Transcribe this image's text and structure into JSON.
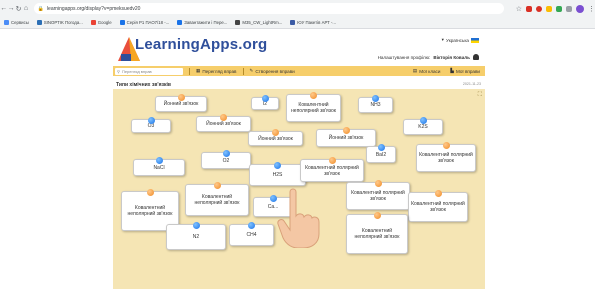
{
  "browser": {
    "url": "learningapps.org/display?v=pmeksuedv20",
    "bookmarks": [
      {
        "label": "Сервисы",
        "color": "#4a8cf6"
      },
      {
        "label": "SINOPTIK Погода...",
        "color": "#2c6fb5"
      },
      {
        "label": "Google",
        "color": "#ea4335"
      },
      {
        "label": "Серія Р1 ПАО7/18 -...",
        "color": "#1a73e8"
      },
      {
        "label": "Завантажити і Пере...",
        "color": "#1a73e8"
      },
      {
        "label": "M35_CW_LightRm...",
        "color": "#444444"
      },
      {
        "label": "ЮУ Пакетів АРТ -...",
        "color": "#3b5ba5"
      }
    ]
  },
  "header": {
    "logo": "LearningApps.org",
    "language": "Українська",
    "profile_label": "Налаштування профілю:",
    "profile_name": "Вікторія Коваль"
  },
  "toolbar": {
    "search_placeholder": "Перегляд вправ",
    "browse": "Перегляд вправ",
    "create": "Створення вправи",
    "classes": "Мої класи",
    "my_apps": "Мої вправи"
  },
  "page": {
    "title": "Типи хімічних зв'язків",
    "date": "2021-11-23"
  },
  "cards": [
    {
      "text": "Йонний зв'язок",
      "pin": "orange"
    },
    {
      "text": "I2",
      "pin": "blue"
    },
    {
      "text": "Ковалентний неполярний зв'язок",
      "pin": "orange"
    },
    {
      "text": "NH3",
      "pin": "blue"
    },
    {
      "text": "K2S",
      "pin": "blue"
    },
    {
      "text": "O3",
      "pin": "blue"
    },
    {
      "text": "Йонний зв'язок",
      "pin": "orange"
    },
    {
      "text": "Йонний зв'язок",
      "pin": "orange"
    },
    {
      "text": "Йонний зв'язок",
      "pin": "orange"
    },
    {
      "text": "BaI2",
      "pin": "blue"
    },
    {
      "text": "Ковалентний полярний зв'язок",
      "pin": "orange"
    },
    {
      "text": "NaCl",
      "pin": "blue"
    },
    {
      "text": "O2",
      "pin": "blue"
    },
    {
      "text": "H2S",
      "pin": "blue"
    },
    {
      "text": "Ковалентний полярний зв'язок",
      "pin": "orange"
    },
    {
      "text": "Ковалентний полярний зв'язок",
      "pin": "orange"
    },
    {
      "text": "Ковалентний неполярний зв'язок",
      "pin": "orange"
    },
    {
      "text": "Ковалентний неполярний зв'язок",
      "pin": "orange"
    },
    {
      "text": "Ca...",
      "pin": "blue"
    },
    {
      "text": "Ковалентний полярний зв'язок",
      "pin": "orange"
    },
    {
      "text": "N2",
      "pin": "blue"
    },
    {
      "text": "CH4",
      "pin": "blue"
    },
    {
      "text": "Ковалентний неполярний зв'язок",
      "pin": "orange"
    }
  ]
}
